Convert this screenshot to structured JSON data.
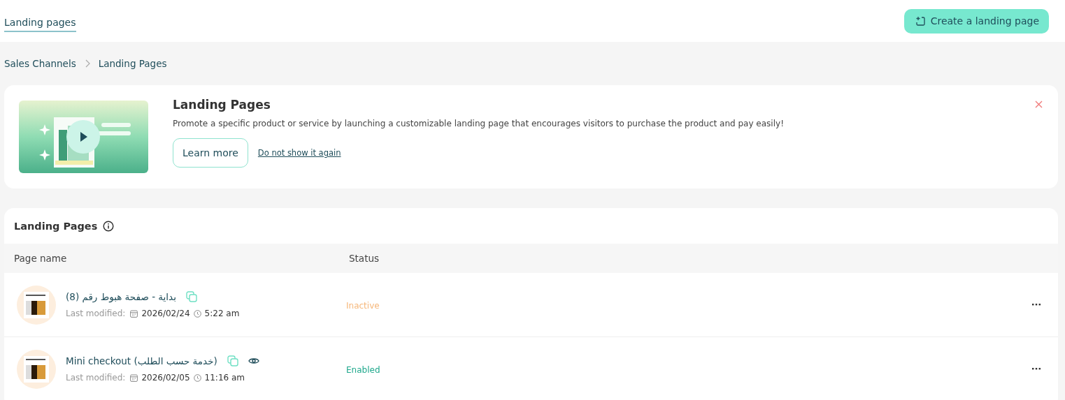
{
  "top_tab": {
    "label": "Landing pages",
    "selected": true
  },
  "create_button": "Create a landing page",
  "breadcrumb": [
    "Sales Channels",
    "Landing Pages"
  ],
  "banner": {
    "title": "Landing Pages",
    "description": "Promote a specific product or service by launching a customizable landing page that encourages visitors to purchase the product and pay easily!",
    "learn_more": "Learn more",
    "dismiss_link": "Do not show it again"
  },
  "table": {
    "title": "Landing Pages",
    "columns": [
      "Page name",
      "Status"
    ],
    "rows": [
      {
        "name": "بداية - صفحة هبوط رقم (8)",
        "preview": false,
        "modified_label": "Last modified:",
        "date": "2026/02/24",
        "time": "5:22 am",
        "status": {
          "label": "Inactive",
          "kind": "inactive"
        }
      },
      {
        "name": "Mini checkout (خدمة حسب الطلب)",
        "preview": true,
        "modified_label": "Last modified:",
        "date": "2026/02/05",
        "time": "11:16 am",
        "status": {
          "label": "Enabled",
          "kind": "enabled"
        }
      }
    ]
  }
}
